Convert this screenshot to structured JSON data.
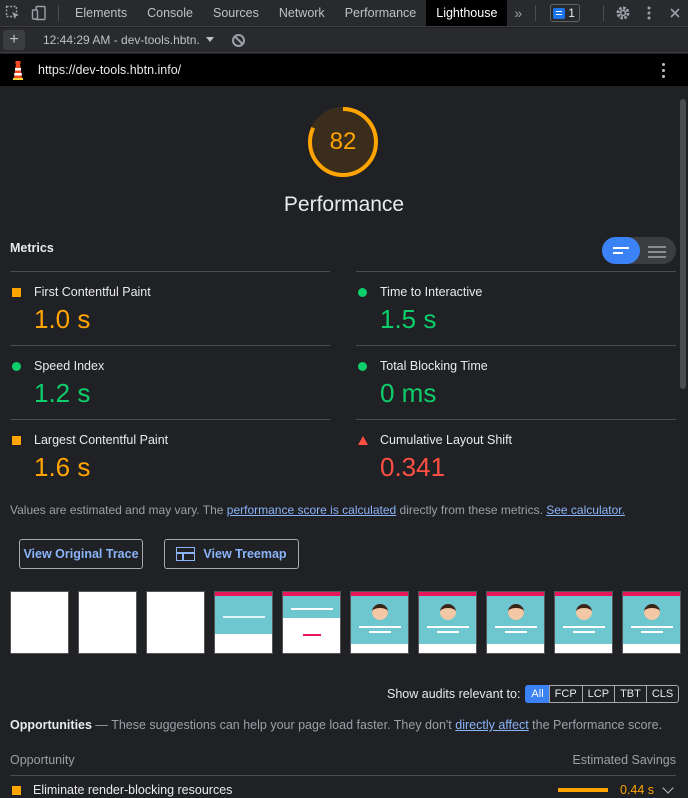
{
  "tabbar": {
    "tabs": [
      "Elements",
      "Console",
      "Sources",
      "Network",
      "Performance",
      "Lighthouse"
    ],
    "active_tab": "Lighthouse",
    "more_symbol": "»",
    "issues_count": "1"
  },
  "toolbar": {
    "report_label": "12:44:29 AM - dev-tools.hbtn.",
    "plus_symbol": "+"
  },
  "urlbar": {
    "url": "https://dev-tools.hbtn.info/"
  },
  "gauge": {
    "score": "82",
    "score_fraction": 0.82,
    "title": "Performance",
    "color": "#ffa400"
  },
  "metrics": {
    "title": "Metrics",
    "items": [
      {
        "label": "First Contentful Paint",
        "value": "1.0 s",
        "rating": "average"
      },
      {
        "label": "Time to Interactive",
        "value": "1.5 s",
        "rating": "pass"
      },
      {
        "label": "Speed Index",
        "value": "1.2 s",
        "rating": "pass"
      },
      {
        "label": "Total Blocking Time",
        "value": "0 ms",
        "rating": "pass"
      },
      {
        "label": "Largest Contentful Paint",
        "value": "1.6 s",
        "rating": "average"
      },
      {
        "label": "Cumulative Layout Shift",
        "value": "0.341",
        "rating": "fail"
      }
    ],
    "note_prefix": "Values are estimated and may vary. The ",
    "note_link": "performance score is calculated",
    "note_middle": " directly from these metrics. ",
    "note_link2": "See calculator."
  },
  "buttons": {
    "view_trace": "View Original Trace",
    "view_treemap": "View Treemap"
  },
  "audits_filter": {
    "label": "Show audits relevant to:",
    "chips": [
      "All",
      "FCP",
      "LCP",
      "TBT",
      "CLS"
    ]
  },
  "opportunities": {
    "title": "Opportunities",
    "dash": " — ",
    "text_before": "These suggestions can help your page load faster. They don't ",
    "link": "directly affect",
    "text_after": " the Performance score.",
    "col_opportunity": "Opportunity",
    "col_savings": "Estimated Savings",
    "rows": [
      {
        "label": "Eliminate render-blocking resources",
        "saving": "0.44 s"
      }
    ]
  },
  "colors": {
    "average": "#ffa400",
    "pass": "#0cce6b",
    "fail": "#ff4e42",
    "accent": "#3b82f6",
    "link": "#8ab4f8"
  }
}
